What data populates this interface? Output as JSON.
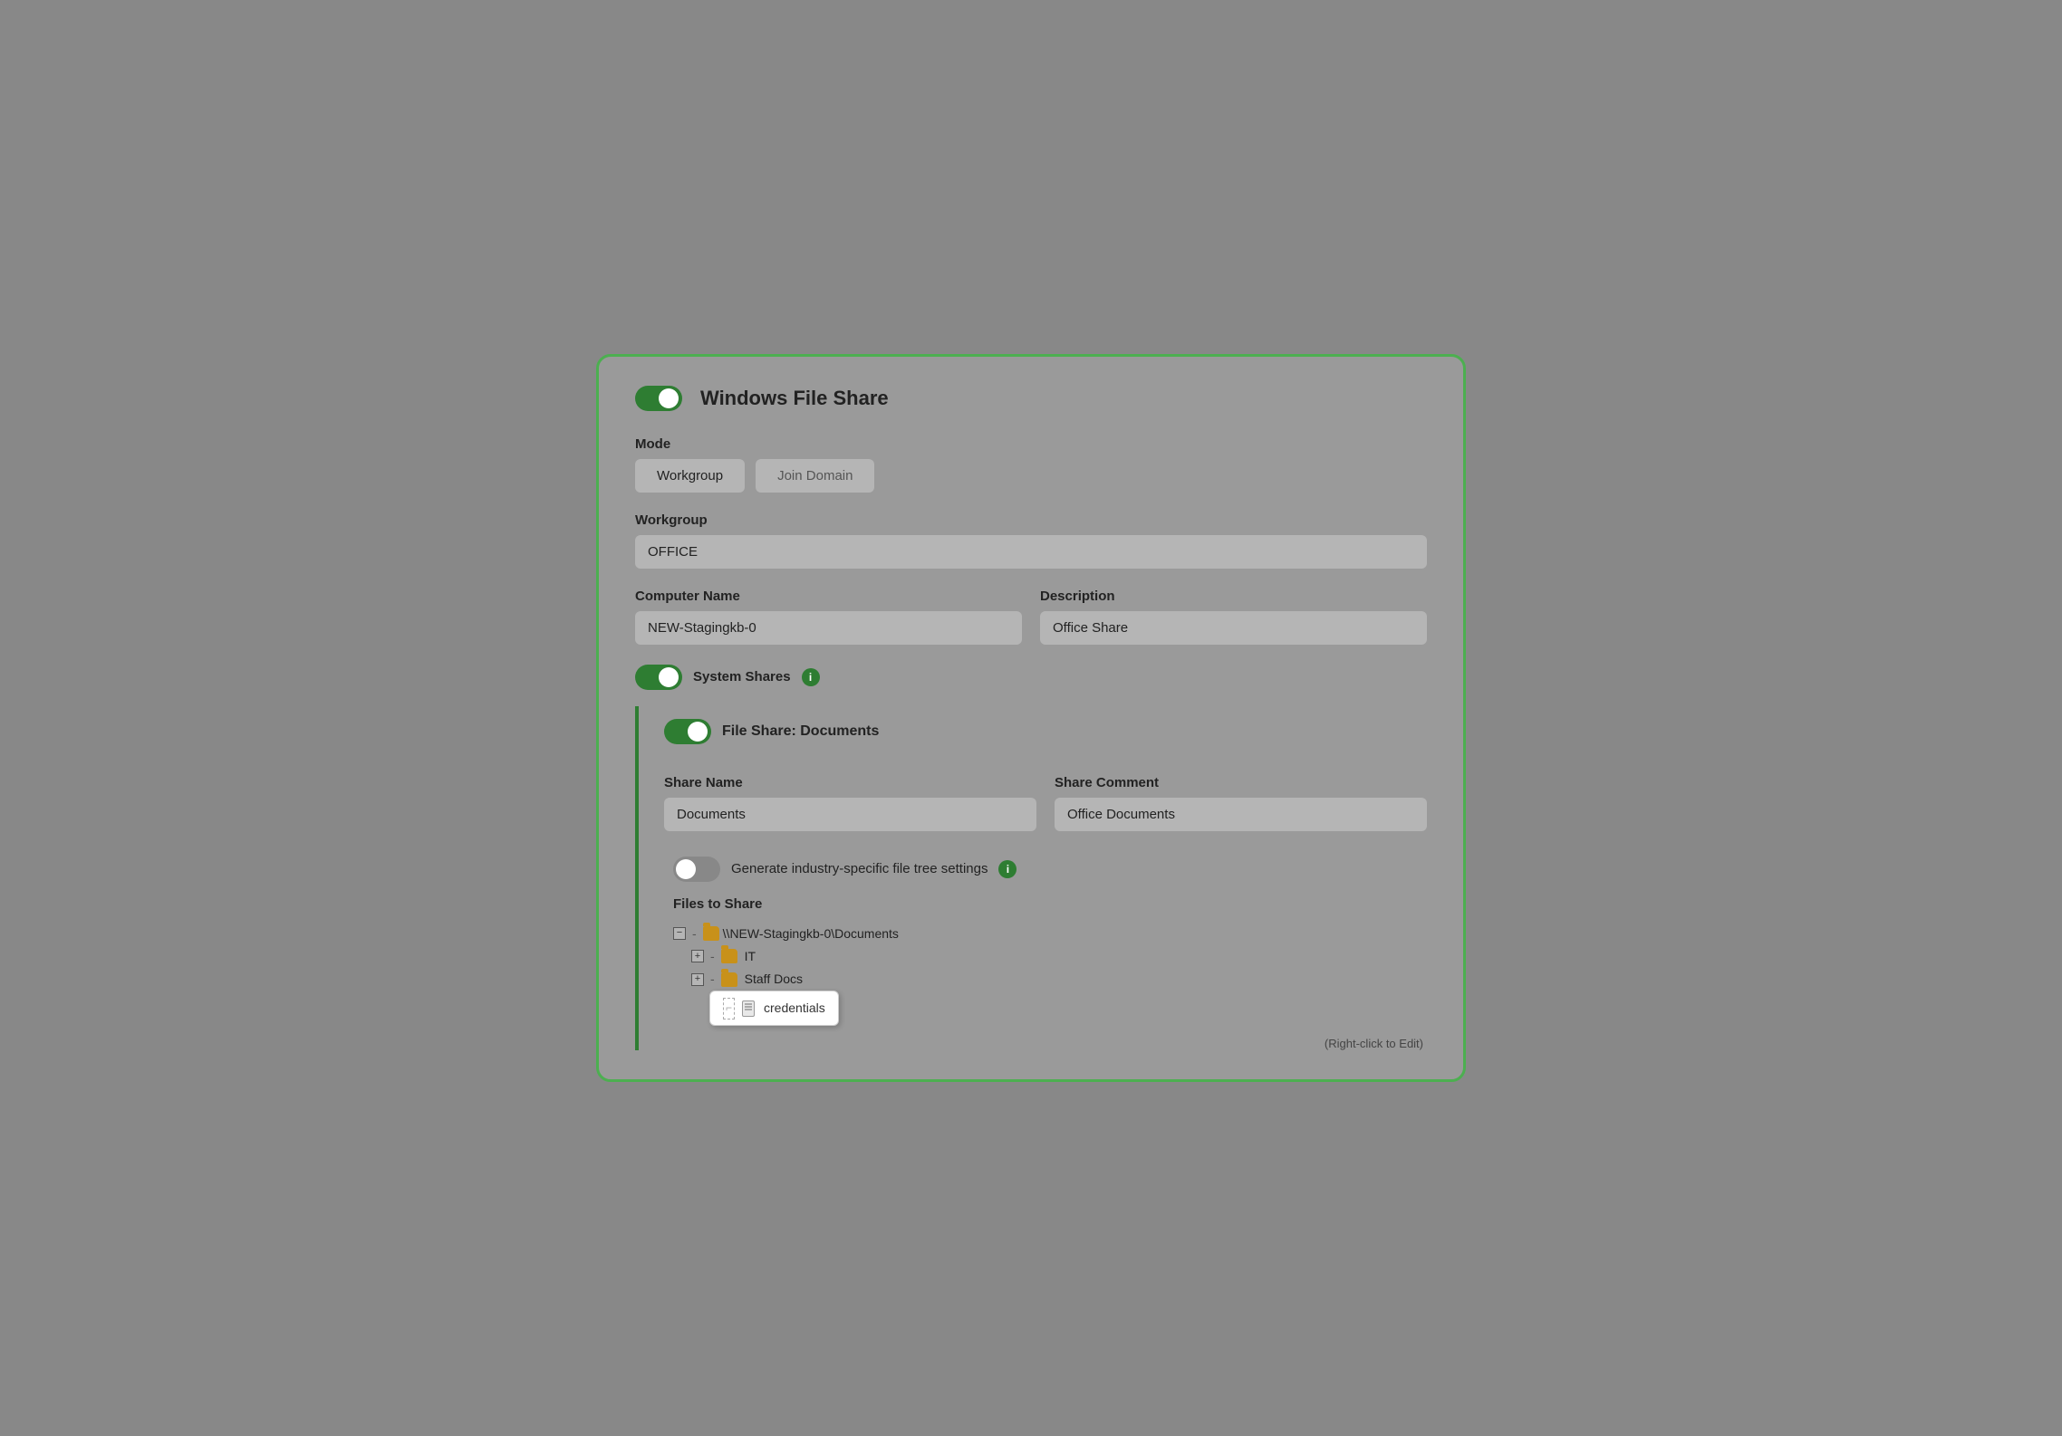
{
  "window": {
    "title": "Windows File Share",
    "border_color": "#4caf50"
  },
  "mode_section": {
    "label": "Mode",
    "options": [
      "Workgroup",
      "Join Domain"
    ],
    "active": "Workgroup"
  },
  "workgroup_section": {
    "label": "Workgroup",
    "value": "OFFICE"
  },
  "computer_name_section": {
    "label": "Computer Name",
    "value": "NEW-Stagingkb-0"
  },
  "description_section": {
    "label": "Description",
    "value": "Office Share"
  },
  "system_shares": {
    "label": "System Shares",
    "enabled": true,
    "info": "i"
  },
  "file_share_documents": {
    "label": "File Share: Documents",
    "enabled": true
  },
  "share_name": {
    "label": "Share Name",
    "value": "Documents"
  },
  "share_comment": {
    "label": "Share Comment",
    "value": "Office Documents"
  },
  "generate_toggle": {
    "label": "Generate industry-specific file tree settings",
    "enabled": false,
    "info": "i"
  },
  "files_to_share": {
    "label": "Files to Share",
    "tree": {
      "root": "\\\\NEW-Stagingkb-0\\Documents",
      "children": [
        {
          "name": "IT",
          "type": "folder"
        },
        {
          "name": "Staff Docs",
          "type": "folder"
        },
        {
          "name": "credentials",
          "type": "file",
          "highlighted": true
        }
      ]
    }
  },
  "right_click_hint": "(Right-click to Edit)"
}
